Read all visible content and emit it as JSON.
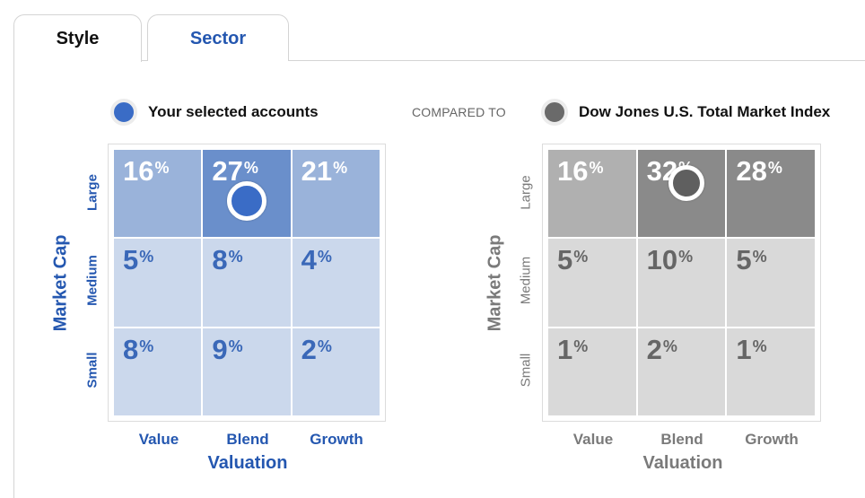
{
  "tabs": [
    {
      "label": "Style",
      "active": true
    },
    {
      "label": "Sector",
      "active": false
    }
  ],
  "legend": {
    "selected_label": "Your selected accounts",
    "compared_to": "COMPARED TO",
    "benchmark_label": "Dow Jones U.S. Total Market Index"
  },
  "colors": {
    "accent_blue": "#2457b0",
    "marker_blue": "#3a6cc6",
    "marker_gray": "#5f5f5f",
    "gray_text": "#7a7a7a"
  },
  "chart_data": [
    {
      "type": "heatmap",
      "title": "Your selected accounts",
      "xlabel": "Valuation",
      "ylabel": "Market Cap",
      "x_categories": [
        "Value",
        "Blend",
        "Growth"
      ],
      "y_categories": [
        "Large",
        "Medium",
        "Small"
      ],
      "unit": "%",
      "values": [
        [
          16,
          27,
          21
        ],
        [
          5,
          8,
          4
        ],
        [
          8,
          9,
          2
        ]
      ],
      "marker": {
        "row": "Large",
        "col": "Blend"
      }
    },
    {
      "type": "heatmap",
      "title": "Dow Jones U.S. Total Market Index",
      "xlabel": "Valuation",
      "ylabel": "Market Cap",
      "x_categories": [
        "Value",
        "Blend",
        "Growth"
      ],
      "y_categories": [
        "Large",
        "Medium",
        "Small"
      ],
      "unit": "%",
      "values": [
        [
          16,
          32,
          28
        ],
        [
          5,
          10,
          5
        ],
        [
          1,
          2,
          1
        ]
      ],
      "marker": {
        "row": "Large",
        "col": "Blend"
      }
    }
  ]
}
